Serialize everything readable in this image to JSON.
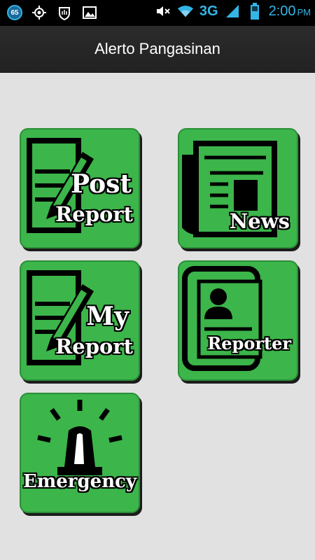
{
  "status_bar": {
    "notification_count": "65",
    "network": "3G",
    "time": "2:00",
    "ampm": "PM"
  },
  "action_bar": {
    "title": "Alerto Pangasinan"
  },
  "tiles": {
    "post_report": {
      "line1": "Post",
      "line2": "Report",
      "icon": "pencil-document-icon"
    },
    "news": {
      "label": "News",
      "icon": "newspaper-icon"
    },
    "my_report": {
      "line1": "My",
      "line2": "Report",
      "icon": "pencil-document-icon"
    },
    "reporter": {
      "label": "Reporter",
      "icon": "id-card-icon"
    },
    "emergency": {
      "label": "Emergency",
      "icon": "siren-icon"
    }
  },
  "colors": {
    "tile_green": "#3cb54a",
    "status_blue": "#33b5e5",
    "background": "#e1e1e1"
  }
}
